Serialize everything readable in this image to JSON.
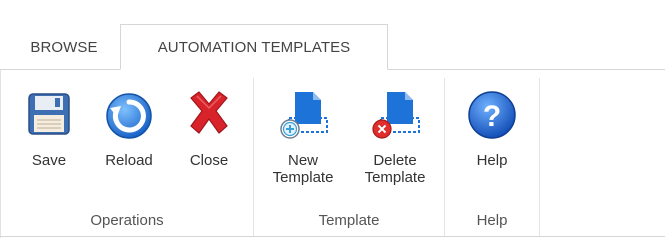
{
  "tabs": [
    {
      "label": "BROWSE",
      "active": false
    },
    {
      "label": "AUTOMATION TEMPLATES",
      "active": true
    }
  ],
  "groups": {
    "operations": {
      "label": "Operations",
      "buttons": {
        "save": {
          "label": "Save",
          "icon": "floppy-disk-icon"
        },
        "reload": {
          "label": "Reload",
          "icon": "reload-icon"
        },
        "close": {
          "label": "Close",
          "icon": "red-x-close-icon"
        }
      }
    },
    "template": {
      "label": "Template",
      "buttons": {
        "new": {
          "label_line1": "New",
          "label_line2": "Template",
          "icon": "new-template-icon"
        },
        "delete": {
          "label_line1": "Delete",
          "label_line2": "Template",
          "icon": "delete-template-icon"
        }
      }
    },
    "help": {
      "label": "Help",
      "buttons": {
        "help": {
          "label": "Help",
          "icon": "help-icon"
        }
      }
    }
  },
  "colors": {
    "accent_blue": "#1e73d8",
    "close_red": "#d8232a",
    "border": "#d6d6d6"
  }
}
